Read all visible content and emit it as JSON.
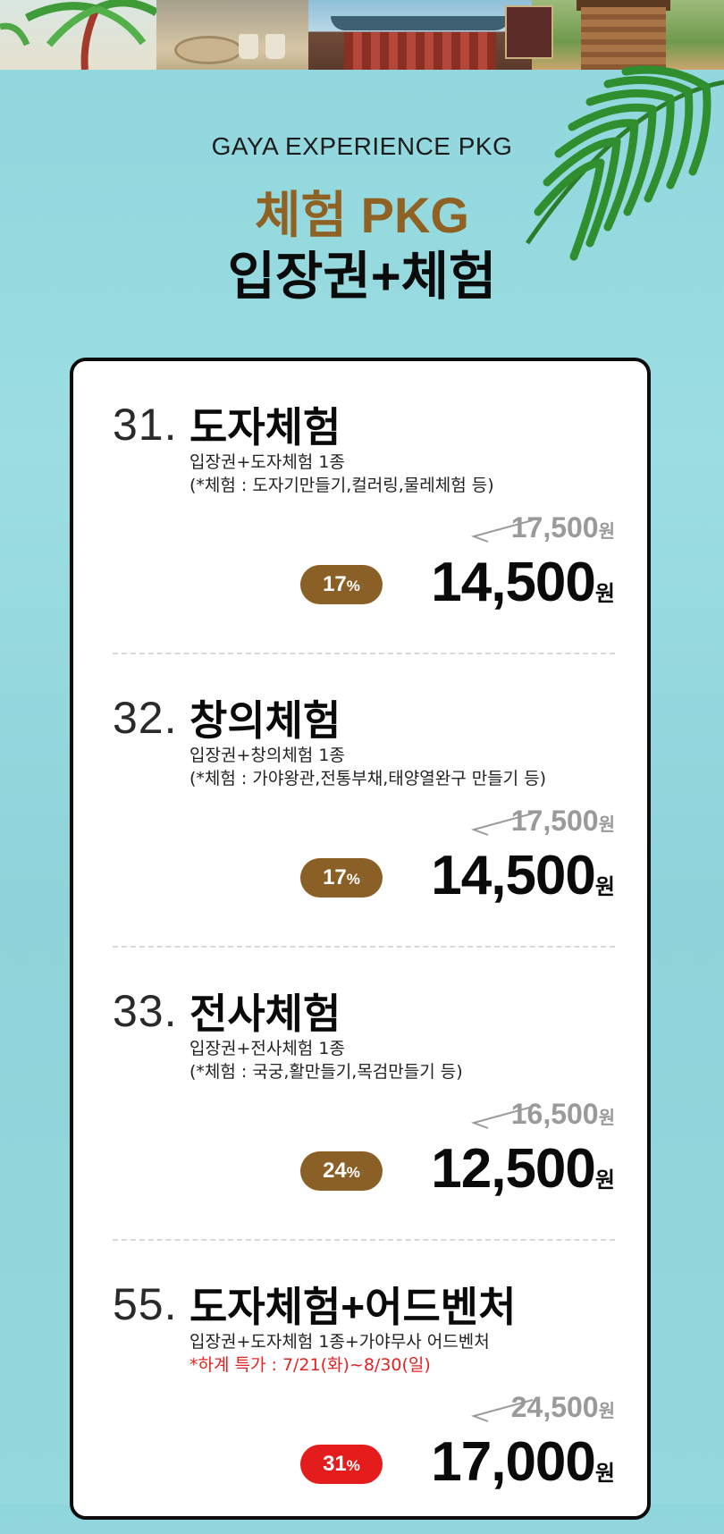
{
  "header": {
    "subtitle_en": "GAYA EXPERIENCE PKG",
    "title_gold": "체험 PKG",
    "title_black": "입장권+체험"
  },
  "colors": {
    "background": "#8fd6dc",
    "gold": "#8f6224",
    "badge_brown": "#8a6026",
    "badge_red": "#e51c1c",
    "notice_red": "#e52222"
  },
  "items": [
    {
      "number": "31.",
      "name": "도자체험",
      "desc1": "입장권+도자체험 1종",
      "desc2": "(*체험 : 도자기만들기,컬러링,물레체험 등)",
      "original_price": "17,500",
      "discount": "17",
      "price": "14,500",
      "won": "원",
      "pct": "%"
    },
    {
      "number": "32.",
      "name": "창의체험",
      "desc1": "입장권+창의체험 1종",
      "desc2": "(*체험 : 가야왕관,전통부채,태양열완구 만들기 등)",
      "original_price": "17,500",
      "discount": "17",
      "price": "14,500",
      "won": "원",
      "pct": "%"
    },
    {
      "number": "33.",
      "name": "전사체험",
      "desc1": "입장권+전사체험 1종",
      "desc2": "(*체험 : 국궁,활만들기,목검만들기 등)",
      "original_price": "16,500",
      "discount": "24",
      "price": "12,500",
      "won": "원",
      "pct": "%"
    },
    {
      "number": "55.",
      "name": "도자체험+어드벤처",
      "desc1": "입장권+도자체험 1종+가야무사 어드벤처",
      "desc2": "*하계 특가 : 7/21(화)~8/30(일)",
      "original_price": "24,500",
      "discount": "31",
      "price": "17,000",
      "won": "원",
      "pct": "%"
    }
  ]
}
